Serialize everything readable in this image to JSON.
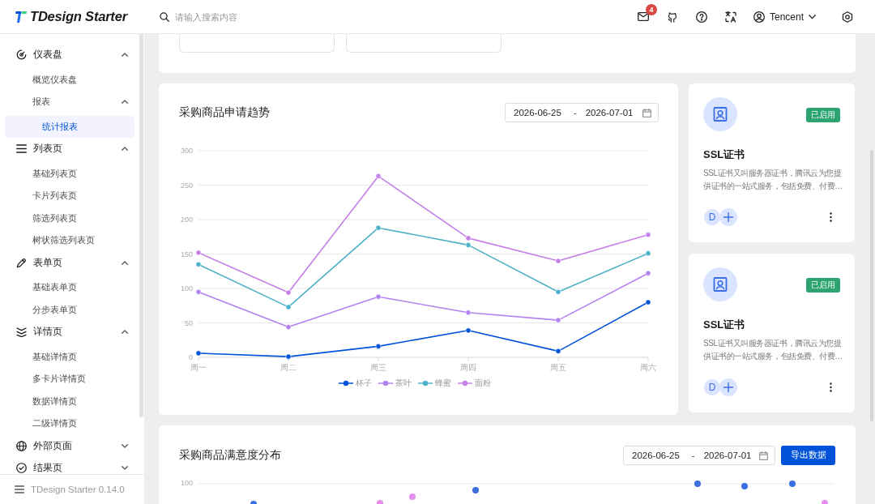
{
  "header": {
    "logo": "TDesign Starter",
    "search": {
      "placeholder": "请输入搜索内容"
    },
    "notification_badge": "4",
    "user": {
      "name": "Tencent"
    }
  },
  "sidebar": {
    "items": [
      {
        "label": "仪表盘",
        "selected": false,
        "expanded": true,
        "children": [
          {
            "label": "概览仪表盘",
            "selected": false
          },
          {
            "label": "报表",
            "selected": false,
            "expanded": true,
            "children": [
              {
                "label": "统计报表",
                "selected": true
              }
            ]
          }
        ]
      },
      {
        "label": "列表页",
        "selected": false,
        "expanded": true,
        "children": [
          {
            "label": "基础列表页",
            "selected": false
          },
          {
            "label": "卡片列表页",
            "selected": false
          },
          {
            "label": "筛选列表页",
            "selected": false
          },
          {
            "label": "树状筛选列表页",
            "selected": false
          }
        ]
      },
      {
        "label": "表单页",
        "selected": false,
        "expanded": true,
        "children": [
          {
            "label": "基础表单页",
            "selected": false
          },
          {
            "label": "分步表单页",
            "selected": false
          }
        ]
      },
      {
        "label": "详情页",
        "selected": false,
        "expanded": true,
        "children": [
          {
            "label": "基础详情页",
            "selected": false
          },
          {
            "label": "多卡片详情页",
            "selected": false
          },
          {
            "label": "数据详情页",
            "selected": false
          },
          {
            "label": "二级详情页",
            "selected": false
          }
        ]
      },
      {
        "label": "外部页面",
        "selected": false,
        "expanded": false
      },
      {
        "label": "结果页",
        "selected": false,
        "expanded": false
      }
    ],
    "footer": "TDesign Starter 0.14.0"
  },
  "trend_card": {
    "title": "采购商品申请趋势",
    "date_range": {
      "start": "2026-06-25",
      "separator": "-",
      "end": "2026-07-01"
    },
    "chart_data": {
      "type": "line",
      "categories": [
        "周一",
        "周二",
        "周三",
        "周四",
        "周五",
        "周六"
      ],
      "ylim": [
        0,
        300
      ],
      "yticks": [
        0,
        50,
        100,
        150,
        200,
        250,
        300
      ],
      "grid": true,
      "legend": "bottom",
      "marker": "circle",
      "series": [
        {
          "name": "杯子",
          "color": "#0052d9",
          "values": [
            6,
            1,
            16,
            39,
            9,
            80
          ]
        },
        {
          "name": "茶叶",
          "color": "#b381f0",
          "values": [
            95,
            44,
            88,
            65,
            54,
            122
          ]
        },
        {
          "name": "蜂蜜",
          "color": "#4cb1c8",
          "values": [
            135,
            73,
            188,
            163,
            95,
            151
          ]
        },
        {
          "name": "面粉",
          "color": "#c57fe8",
          "values": [
            152,
            94,
            263,
            173,
            140,
            178
          ]
        }
      ]
    }
  },
  "cert_cards": [
    {
      "status": "已启用",
      "title": "SSL证书",
      "description": "SSL证书又叫服务器证书，腾讯云为您提供证书的一站式服务，包括免费、付费…",
      "avatars": [
        "D"
      ]
    },
    {
      "status": "已启用",
      "title": "SSL证书",
      "description": "SSL证书又叫服务器证书，腾讯云为您提供证书的一站式服务，包括免费、付费…",
      "avatars": [
        "D"
      ]
    }
  ],
  "satisfaction_card": {
    "title": "采购商品满意度分布",
    "date_range": {
      "start": "2026-06-25",
      "separator": "-",
      "end": "2026-07-01"
    },
    "export_button": "导出数据",
    "y_tick_label": "100"
  }
}
